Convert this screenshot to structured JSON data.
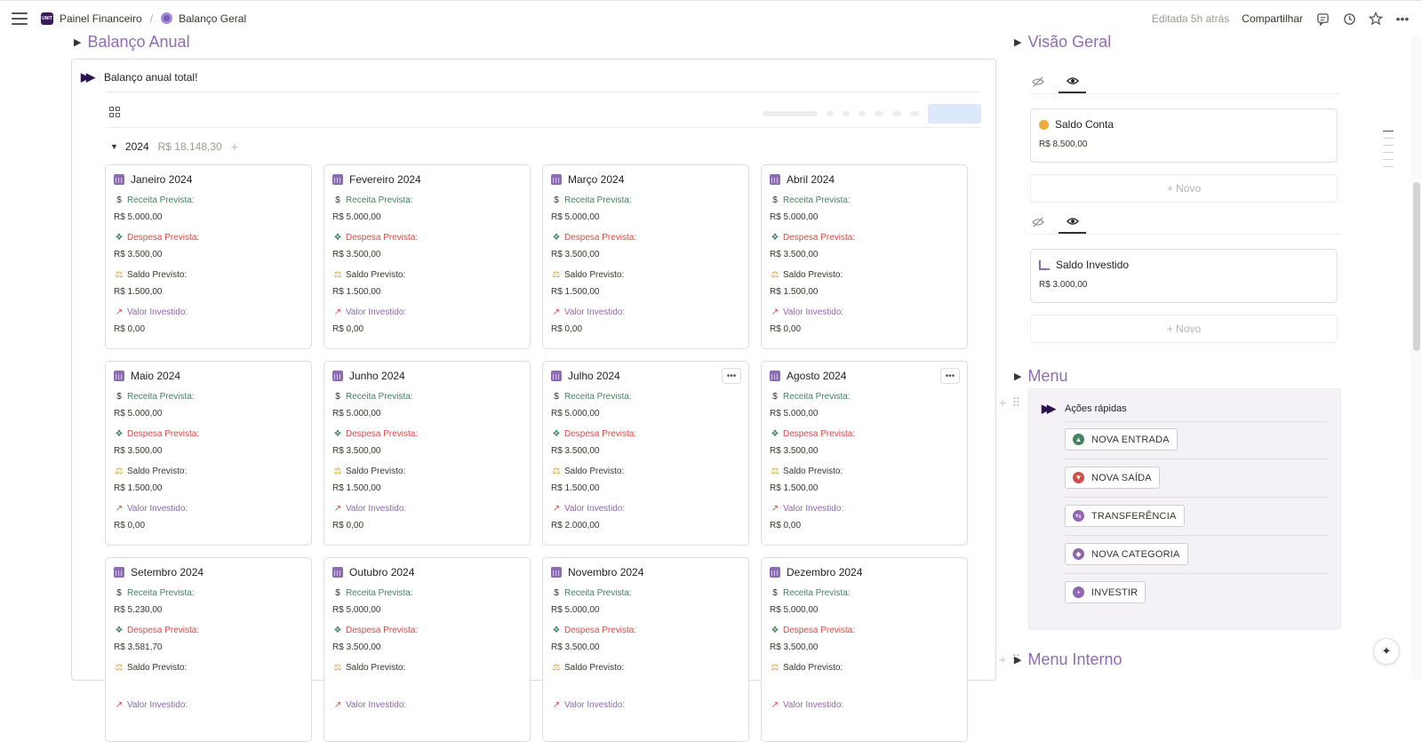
{
  "topbar": {
    "breadcrumb": [
      "Painel Financeiro",
      "Balanço Geral"
    ],
    "logo_text": "UNIT",
    "edited": "Editada 5h atrás",
    "share": "Compartilhar"
  },
  "main": {
    "section_title": "Balanço Anual",
    "callout_text": "Balanço anual total!",
    "group": {
      "year": "2024",
      "total": "R$ 18.148,30"
    },
    "labels": {
      "receita": "Receita Prevista:",
      "despesa": "Despesa Prevista:",
      "saldo": "Saldo Previsto:",
      "investido": "Valor Investido:"
    },
    "cards": [
      {
        "title": "Janeiro 2024",
        "receita": "R$ 5.000,00",
        "despesa": "R$ 3.500,00",
        "saldo": "R$ 1.500,00",
        "investido": "R$ 0,00"
      },
      {
        "title": "Fevereiro 2024",
        "receita": "R$ 5.000,00",
        "despesa": "R$ 3.500,00",
        "saldo": "R$ 1.500,00",
        "investido": "R$ 0,00"
      },
      {
        "title": "Março 2024",
        "receita": "R$ 5.000,00",
        "despesa": "R$ 3.500,00",
        "saldo": "R$ 1.500,00",
        "investido": "R$ 0,00"
      },
      {
        "title": "Abril 2024",
        "receita": "R$ 5.000,00",
        "despesa": "R$ 3.500,00",
        "saldo": "R$ 1.500,00",
        "investido": "R$ 0,00"
      },
      {
        "title": "Maio 2024",
        "receita": "R$ 5.000,00",
        "despesa": "R$ 3.500,00",
        "saldo": "R$ 1.500,00",
        "investido": "R$ 0,00"
      },
      {
        "title": "Junho 2024",
        "receita": "R$ 5.000,00",
        "despesa": "R$ 3.500,00",
        "saldo": "R$ 1.500,00",
        "investido": "R$ 0,00"
      },
      {
        "title": "Julho 2024",
        "receita": "R$ 5.000,00",
        "despesa": "R$ 3.500,00",
        "saldo": "R$ 1.500,00",
        "investido": "R$ 2.000,00"
      },
      {
        "title": "Agosto 2024",
        "receita": "R$ 5.000,00",
        "despesa": "R$ 3.500,00",
        "saldo": "R$ 1.500,00",
        "investido": "R$ 0,00"
      },
      {
        "title": "Setembro 2024",
        "receita": "R$ 5.230,00",
        "despesa": "R$ 3.581,70",
        "saldo": "",
        "investido": ""
      },
      {
        "title": "Outubro 2024",
        "receita": "R$ 5.000,00",
        "despesa": "R$ 3.500,00",
        "saldo": "",
        "investido": ""
      },
      {
        "title": "Novembro 2024",
        "receita": "R$ 5.000,00",
        "despesa": "R$ 3.500,00",
        "saldo": "",
        "investido": ""
      },
      {
        "title": "Dezembro 2024",
        "receita": "R$ 5.000,00",
        "despesa": "R$ 3.500,00",
        "saldo": "",
        "investido": ""
      }
    ]
  },
  "overview": {
    "section_title": "Visão Geral",
    "saldo_conta": {
      "title": "Saldo Conta",
      "value": "R$ 8.500,00"
    },
    "saldo_investido": {
      "title": "Saldo Investido",
      "value": "R$ 3.000,00"
    },
    "new_label": "+ Novo"
  },
  "menu": {
    "section_title": "Menu",
    "heading": "Ações rápidas",
    "buttons": [
      {
        "label": "NOVA ENTRADA",
        "color": "#448361",
        "glyph": "▲"
      },
      {
        "label": "NOVA SAÍDA",
        "color": "#d44c47",
        "glyph": "▼"
      },
      {
        "label": "TRANSFERÊNCIA",
        "color": "#9065b0",
        "glyph": "⇆"
      },
      {
        "label": "NOVA CATEGORIA",
        "color": "#9065b0",
        "glyph": "◆"
      },
      {
        "label": "INVESTIR",
        "color": "#9065b0",
        "glyph": "+"
      }
    ]
  },
  "menu_interno": {
    "section_title": "Menu Interno"
  }
}
